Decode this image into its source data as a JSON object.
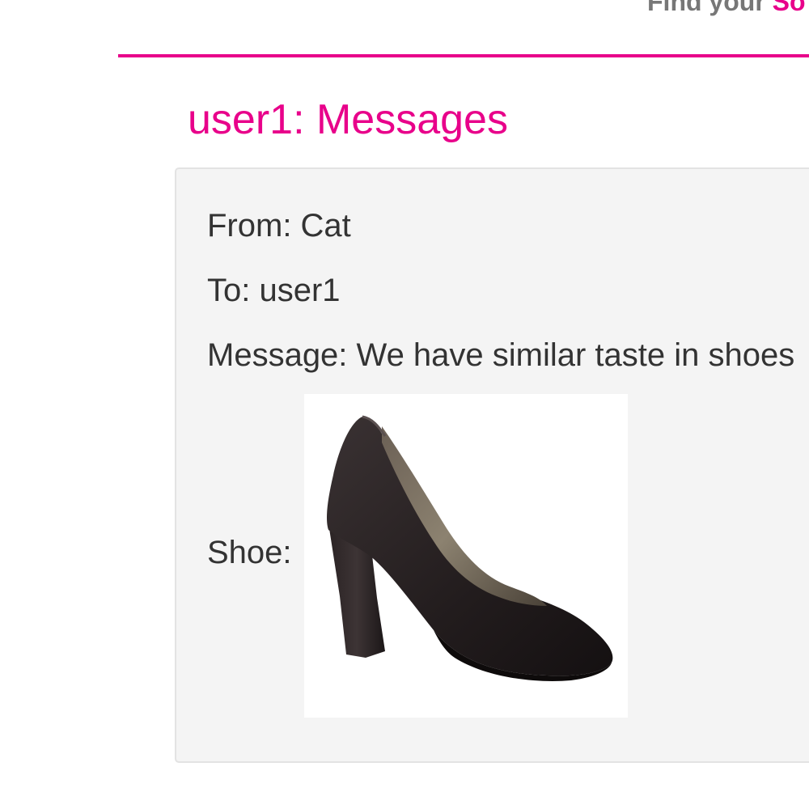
{
  "header": {
    "tagline_prefix": "Find your ",
    "tagline_accent": "So"
  },
  "page": {
    "title": "user1: Messages"
  },
  "message": {
    "from_label": "From: ",
    "from_value": "Cat",
    "to_label": "To: ",
    "to_value": "user1",
    "message_label": "Message: ",
    "message_value": "We have similar taste in shoes",
    "shoe_label": "Shoe:",
    "shoe_image_icon": "black-high-heel-pump-icon"
  },
  "colors": {
    "accent": "#e8008a",
    "card_bg": "#f4f4f4",
    "text": "#333333"
  }
}
